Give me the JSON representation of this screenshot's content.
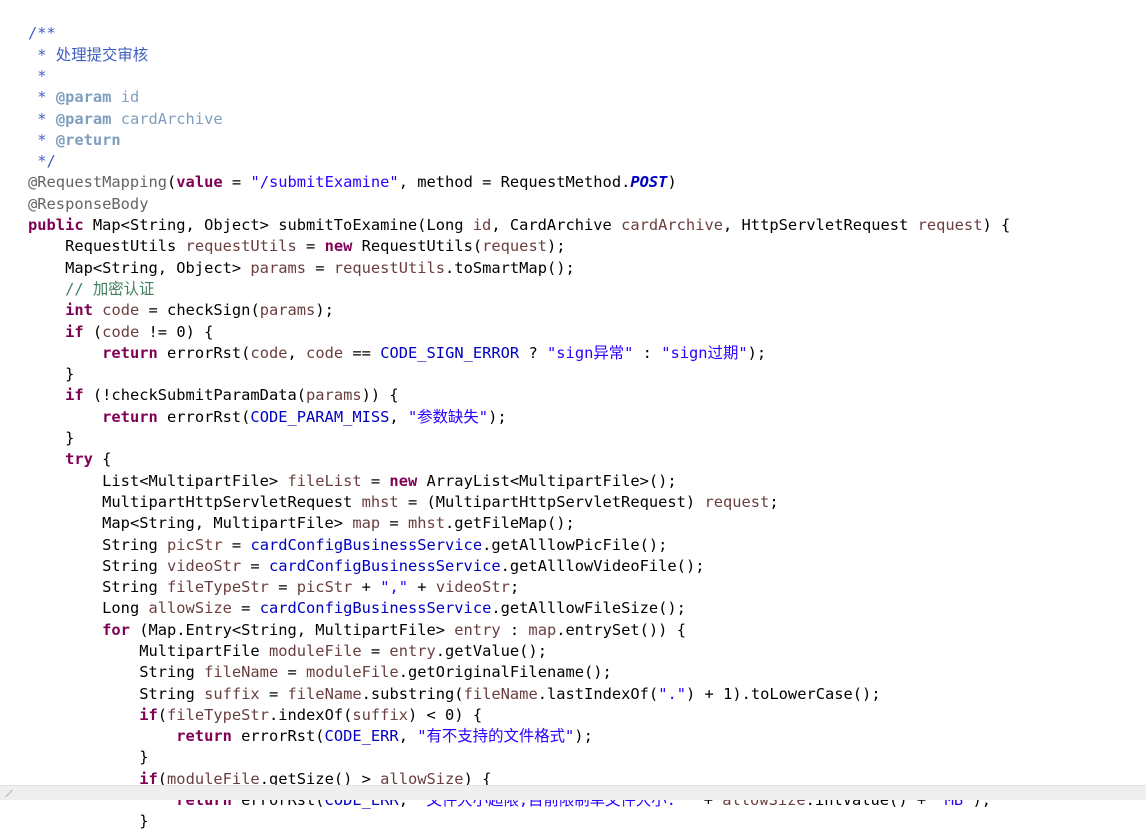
{
  "editor": {
    "language": "Java",
    "background_color": "#ffffff",
    "foreground_color": "#000000",
    "font_size_px": 15.4,
    "line_height_px": 21.3,
    "tab_width_spaces": 4,
    "total_visible_lines": 37
  },
  "theme": {
    "keyword": "#7f0055",
    "string": "#2a00ff",
    "line_comment": "#3f7f5f",
    "javadoc": "#3f5fbf",
    "javadoc_tag": "#7f9fbf",
    "annotation": "#646464",
    "field_reference": "#0000c0",
    "static_final": "#0000c0",
    "local_variable": "#6a3e3e",
    "plain_text": "#000000",
    "status_bar": "#efefef"
  },
  "code": {
    "lines": [
      {
        "n": 1,
        "indent": 0,
        "tokens": [
          {
            "cls": "t-javadoc",
            "text": "/**"
          }
        ]
      },
      {
        "n": 2,
        "indent": 0,
        "tokens": [
          {
            "cls": "t-javadoc",
            "text": " * 处理提交审核"
          }
        ]
      },
      {
        "n": 3,
        "indent": 0,
        "tokens": [
          {
            "cls": "t-javadoc",
            "text": " *"
          }
        ]
      },
      {
        "n": 4,
        "indent": 0,
        "tokens": [
          {
            "cls": "t-javadoc",
            "text": " * "
          },
          {
            "cls": "t-javadoc-tag",
            "text": "@param"
          },
          {
            "cls": "t-javadoc-arg",
            "text": " id"
          }
        ]
      },
      {
        "n": 5,
        "indent": 0,
        "tokens": [
          {
            "cls": "t-javadoc",
            "text": " * "
          },
          {
            "cls": "t-javadoc-tag",
            "text": "@param"
          },
          {
            "cls": "t-javadoc-arg",
            "text": " cardArchive"
          }
        ]
      },
      {
        "n": 6,
        "indent": 0,
        "tokens": [
          {
            "cls": "t-javadoc",
            "text": " * "
          },
          {
            "cls": "t-javadoc-tag",
            "text": "@return"
          }
        ]
      },
      {
        "n": 7,
        "indent": 0,
        "tokens": [
          {
            "cls": "t-javadoc",
            "text": " */"
          }
        ]
      },
      {
        "n": 8,
        "indent": 0,
        "tokens": [
          {
            "cls": "t-annotation",
            "text": "@RequestMapping"
          },
          {
            "cls": "t-plain",
            "text": "("
          },
          {
            "cls": "t-keyword",
            "text": "value"
          },
          {
            "cls": "t-plain",
            "text": " = "
          },
          {
            "cls": "t-string",
            "text": "\"/submitExamine\""
          },
          {
            "cls": "t-plain",
            "text": ", method = RequestMethod."
          },
          {
            "cls": "t-static",
            "text": "POST"
          },
          {
            "cls": "t-plain",
            "text": ")"
          }
        ]
      },
      {
        "n": 9,
        "indent": 0,
        "tokens": [
          {
            "cls": "t-annotation",
            "text": "@ResponseBody"
          }
        ]
      },
      {
        "n": 10,
        "indent": 0,
        "tokens": [
          {
            "cls": "t-keyword",
            "text": "public"
          },
          {
            "cls": "t-plain",
            "text": " Map<String, Object> submitToExamine(Long "
          },
          {
            "cls": "t-local",
            "text": "id"
          },
          {
            "cls": "t-plain",
            "text": ", CardArchive "
          },
          {
            "cls": "t-local",
            "text": "cardArchive"
          },
          {
            "cls": "t-plain",
            "text": ", HttpServletRequest "
          },
          {
            "cls": "t-local",
            "text": "request"
          },
          {
            "cls": "t-plain",
            "text": ") {"
          }
        ]
      },
      {
        "n": 11,
        "indent": 1,
        "tokens": [
          {
            "cls": "t-plain",
            "text": "RequestUtils "
          },
          {
            "cls": "t-local",
            "text": "requestUtils"
          },
          {
            "cls": "t-plain",
            "text": " = "
          },
          {
            "cls": "t-keyword",
            "text": "new"
          },
          {
            "cls": "t-plain",
            "text": " RequestUtils("
          },
          {
            "cls": "t-local",
            "text": "request"
          },
          {
            "cls": "t-plain",
            "text": ");"
          }
        ]
      },
      {
        "n": 12,
        "indent": 1,
        "tokens": [
          {
            "cls": "t-plain",
            "text": "Map<String, Object> "
          },
          {
            "cls": "t-local",
            "text": "params"
          },
          {
            "cls": "t-plain",
            "text": " = "
          },
          {
            "cls": "t-local",
            "text": "requestUtils"
          },
          {
            "cls": "t-plain",
            "text": ".toSmartMap();"
          }
        ]
      },
      {
        "n": 13,
        "indent": 1,
        "tokens": [
          {
            "cls": "t-comment",
            "text": "// 加密认证"
          }
        ]
      },
      {
        "n": 14,
        "indent": 1,
        "tokens": [
          {
            "cls": "t-keyword",
            "text": "int"
          },
          {
            "cls": "t-plain",
            "text": " "
          },
          {
            "cls": "t-local",
            "text": "code"
          },
          {
            "cls": "t-plain",
            "text": " = checkSign("
          },
          {
            "cls": "t-local",
            "text": "params"
          },
          {
            "cls": "t-plain",
            "text": ");"
          }
        ]
      },
      {
        "n": 15,
        "indent": 1,
        "tokens": [
          {
            "cls": "t-keyword",
            "text": "if"
          },
          {
            "cls": "t-plain",
            "text": " ("
          },
          {
            "cls": "t-local",
            "text": "code"
          },
          {
            "cls": "t-plain",
            "text": " != 0) {"
          }
        ]
      },
      {
        "n": 16,
        "indent": 2,
        "tokens": [
          {
            "cls": "t-keyword",
            "text": "return"
          },
          {
            "cls": "t-plain",
            "text": " errorRst("
          },
          {
            "cls": "t-local",
            "text": "code"
          },
          {
            "cls": "t-plain",
            "text": ", "
          },
          {
            "cls": "t-local",
            "text": "code"
          },
          {
            "cls": "t-plain",
            "text": " == "
          },
          {
            "cls": "t-const",
            "text": "CODE_SIGN_ERROR"
          },
          {
            "cls": "t-plain",
            "text": " ? "
          },
          {
            "cls": "t-string",
            "text": "\"sign异常\""
          },
          {
            "cls": "t-plain",
            "text": " : "
          },
          {
            "cls": "t-string",
            "text": "\"sign过期\""
          },
          {
            "cls": "t-plain",
            "text": ");"
          }
        ]
      },
      {
        "n": 17,
        "indent": 1,
        "tokens": [
          {
            "cls": "t-plain",
            "text": "}"
          }
        ]
      },
      {
        "n": 18,
        "indent": 1,
        "tokens": [
          {
            "cls": "t-keyword",
            "text": "if"
          },
          {
            "cls": "t-plain",
            "text": " (!checkSubmitParamData("
          },
          {
            "cls": "t-local",
            "text": "params"
          },
          {
            "cls": "t-plain",
            "text": ")) {"
          }
        ]
      },
      {
        "n": 19,
        "indent": 2,
        "tokens": [
          {
            "cls": "t-keyword",
            "text": "return"
          },
          {
            "cls": "t-plain",
            "text": " errorRst("
          },
          {
            "cls": "t-const",
            "text": "CODE_PARAM_MISS"
          },
          {
            "cls": "t-plain",
            "text": ", "
          },
          {
            "cls": "t-string",
            "text": "\"参数缺失\""
          },
          {
            "cls": "t-plain",
            "text": ");"
          }
        ]
      },
      {
        "n": 20,
        "indent": 1,
        "tokens": [
          {
            "cls": "t-plain",
            "text": "}"
          }
        ]
      },
      {
        "n": 21,
        "indent": 1,
        "tokens": [
          {
            "cls": "t-keyword",
            "text": "try"
          },
          {
            "cls": "t-plain",
            "text": " {"
          }
        ]
      },
      {
        "n": 22,
        "indent": 2,
        "tokens": [
          {
            "cls": "t-plain",
            "text": "List<MultipartFile> "
          },
          {
            "cls": "t-local",
            "text": "fileList"
          },
          {
            "cls": "t-plain",
            "text": " = "
          },
          {
            "cls": "t-keyword",
            "text": "new"
          },
          {
            "cls": "t-plain",
            "text": " ArrayList<MultipartFile>();"
          }
        ]
      },
      {
        "n": 23,
        "indent": 2,
        "tokens": [
          {
            "cls": "t-plain",
            "text": "MultipartHttpServletRequest "
          },
          {
            "cls": "t-local",
            "text": "mhst"
          },
          {
            "cls": "t-plain",
            "text": " = (MultipartHttpServletRequest) "
          },
          {
            "cls": "t-local",
            "text": "request"
          },
          {
            "cls": "t-plain",
            "text": ";"
          }
        ]
      },
      {
        "n": 24,
        "indent": 2,
        "tokens": [
          {
            "cls": "t-plain",
            "text": "Map<String, MultipartFile> "
          },
          {
            "cls": "t-local",
            "text": "map"
          },
          {
            "cls": "t-plain",
            "text": " = "
          },
          {
            "cls": "t-local",
            "text": "mhst"
          },
          {
            "cls": "t-plain",
            "text": ".getFileMap();"
          }
        ]
      },
      {
        "n": 25,
        "indent": 2,
        "tokens": [
          {
            "cls": "t-plain",
            "text": "String "
          },
          {
            "cls": "t-local",
            "text": "picStr"
          },
          {
            "cls": "t-plain",
            "text": " = "
          },
          {
            "cls": "t-field",
            "text": "cardConfigBusinessService"
          },
          {
            "cls": "t-plain",
            "text": ".getAlllowPicFile();"
          }
        ]
      },
      {
        "n": 26,
        "indent": 2,
        "tokens": [
          {
            "cls": "t-plain",
            "text": "String "
          },
          {
            "cls": "t-local",
            "text": "videoStr"
          },
          {
            "cls": "t-plain",
            "text": " = "
          },
          {
            "cls": "t-field",
            "text": "cardConfigBusinessService"
          },
          {
            "cls": "t-plain",
            "text": ".getAlllowVideoFile();"
          }
        ]
      },
      {
        "n": 27,
        "indent": 2,
        "tokens": [
          {
            "cls": "t-plain",
            "text": "String "
          },
          {
            "cls": "t-local",
            "text": "fileTypeStr"
          },
          {
            "cls": "t-plain",
            "text": " = "
          },
          {
            "cls": "t-local",
            "text": "picStr"
          },
          {
            "cls": "t-plain",
            "text": " + "
          },
          {
            "cls": "t-string",
            "text": "\",\""
          },
          {
            "cls": "t-plain",
            "text": " + "
          },
          {
            "cls": "t-local",
            "text": "videoStr"
          },
          {
            "cls": "t-plain",
            "text": ";"
          }
        ]
      },
      {
        "n": 28,
        "indent": 2,
        "tokens": [
          {
            "cls": "t-plain",
            "text": "Long "
          },
          {
            "cls": "t-local",
            "text": "allowSize"
          },
          {
            "cls": "t-plain",
            "text": " = "
          },
          {
            "cls": "t-field",
            "text": "cardConfigBusinessService"
          },
          {
            "cls": "t-plain",
            "text": ".getAlllowFileSize();"
          }
        ]
      },
      {
        "n": 29,
        "indent": 2,
        "tokens": [
          {
            "cls": "t-keyword",
            "text": "for"
          },
          {
            "cls": "t-plain",
            "text": " (Map.Entry<String, MultipartFile> "
          },
          {
            "cls": "t-local",
            "text": "entry"
          },
          {
            "cls": "t-plain",
            "text": " : "
          },
          {
            "cls": "t-local",
            "text": "map"
          },
          {
            "cls": "t-plain",
            "text": ".entrySet()) {"
          }
        ]
      },
      {
        "n": 30,
        "indent": 3,
        "tokens": [
          {
            "cls": "t-plain",
            "text": "MultipartFile "
          },
          {
            "cls": "t-local",
            "text": "moduleFile"
          },
          {
            "cls": "t-plain",
            "text": " = "
          },
          {
            "cls": "t-local",
            "text": "entry"
          },
          {
            "cls": "t-plain",
            "text": ".getValue();"
          }
        ]
      },
      {
        "n": 31,
        "indent": 3,
        "tokens": [
          {
            "cls": "t-plain",
            "text": "String "
          },
          {
            "cls": "t-local",
            "text": "fileName"
          },
          {
            "cls": "t-plain",
            "text": " = "
          },
          {
            "cls": "t-local",
            "text": "moduleFile"
          },
          {
            "cls": "t-plain",
            "text": ".getOriginalFilename();"
          }
        ]
      },
      {
        "n": 32,
        "indent": 3,
        "tokens": [
          {
            "cls": "t-plain",
            "text": "String "
          },
          {
            "cls": "t-local",
            "text": "suffix"
          },
          {
            "cls": "t-plain",
            "text": " = "
          },
          {
            "cls": "t-local",
            "text": "fileName"
          },
          {
            "cls": "t-plain",
            "text": ".substring("
          },
          {
            "cls": "t-local",
            "text": "fileName"
          },
          {
            "cls": "t-plain",
            "text": ".lastIndexOf("
          },
          {
            "cls": "t-string",
            "text": "\".\""
          },
          {
            "cls": "t-plain",
            "text": ") + 1).toLowerCase();"
          }
        ]
      },
      {
        "n": 33,
        "indent": 3,
        "tokens": [
          {
            "cls": "t-keyword",
            "text": "if"
          },
          {
            "cls": "t-plain",
            "text": "("
          },
          {
            "cls": "t-local",
            "text": "fileTypeStr"
          },
          {
            "cls": "t-plain",
            "text": ".indexOf("
          },
          {
            "cls": "t-local",
            "text": "suffix"
          },
          {
            "cls": "t-plain",
            "text": ") < 0) {"
          }
        ]
      },
      {
        "n": 34,
        "indent": 4,
        "tokens": [
          {
            "cls": "t-keyword",
            "text": "return"
          },
          {
            "cls": "t-plain",
            "text": " errorRst("
          },
          {
            "cls": "t-const",
            "text": "CODE_ERR"
          },
          {
            "cls": "t-plain",
            "text": ", "
          },
          {
            "cls": "t-string",
            "text": "\"有不支持的文件格式\""
          },
          {
            "cls": "t-plain",
            "text": ");"
          }
        ]
      },
      {
        "n": 35,
        "indent": 3,
        "tokens": [
          {
            "cls": "t-plain",
            "text": "}"
          }
        ]
      },
      {
        "n": 36,
        "indent": 3,
        "tokens": [
          {
            "cls": "t-keyword",
            "text": "if"
          },
          {
            "cls": "t-plain",
            "text": "("
          },
          {
            "cls": "t-local",
            "text": "moduleFile"
          },
          {
            "cls": "t-plain",
            "text": ".getSize() > "
          },
          {
            "cls": "t-local",
            "text": "allowSize"
          },
          {
            "cls": "t-plain",
            "text": ") {"
          }
        ]
      },
      {
        "n": 37,
        "indent": 4,
        "tokens": [
          {
            "cls": "t-keyword",
            "text": "return"
          },
          {
            "cls": "t-plain",
            "text": " errorRst("
          },
          {
            "cls": "t-const",
            "text": "CODE_ERR"
          },
          {
            "cls": "t-plain",
            "text": ", "
          },
          {
            "cls": "t-string",
            "text": "\"文件大小超限,目前限制单文件大小: \""
          },
          {
            "cls": "t-plain",
            "text": " + "
          },
          {
            "cls": "t-local",
            "text": "allowSize"
          },
          {
            "cls": "t-plain",
            "text": ".intValue() + "
          },
          {
            "cls": "t-string",
            "text": "\"MB\""
          },
          {
            "cls": "t-plain",
            "text": ");"
          }
        ]
      },
      {
        "n": 38,
        "indent": 3,
        "tokens": [
          {
            "cls": "t-plain",
            "text": "}"
          }
        ]
      }
    ]
  }
}
